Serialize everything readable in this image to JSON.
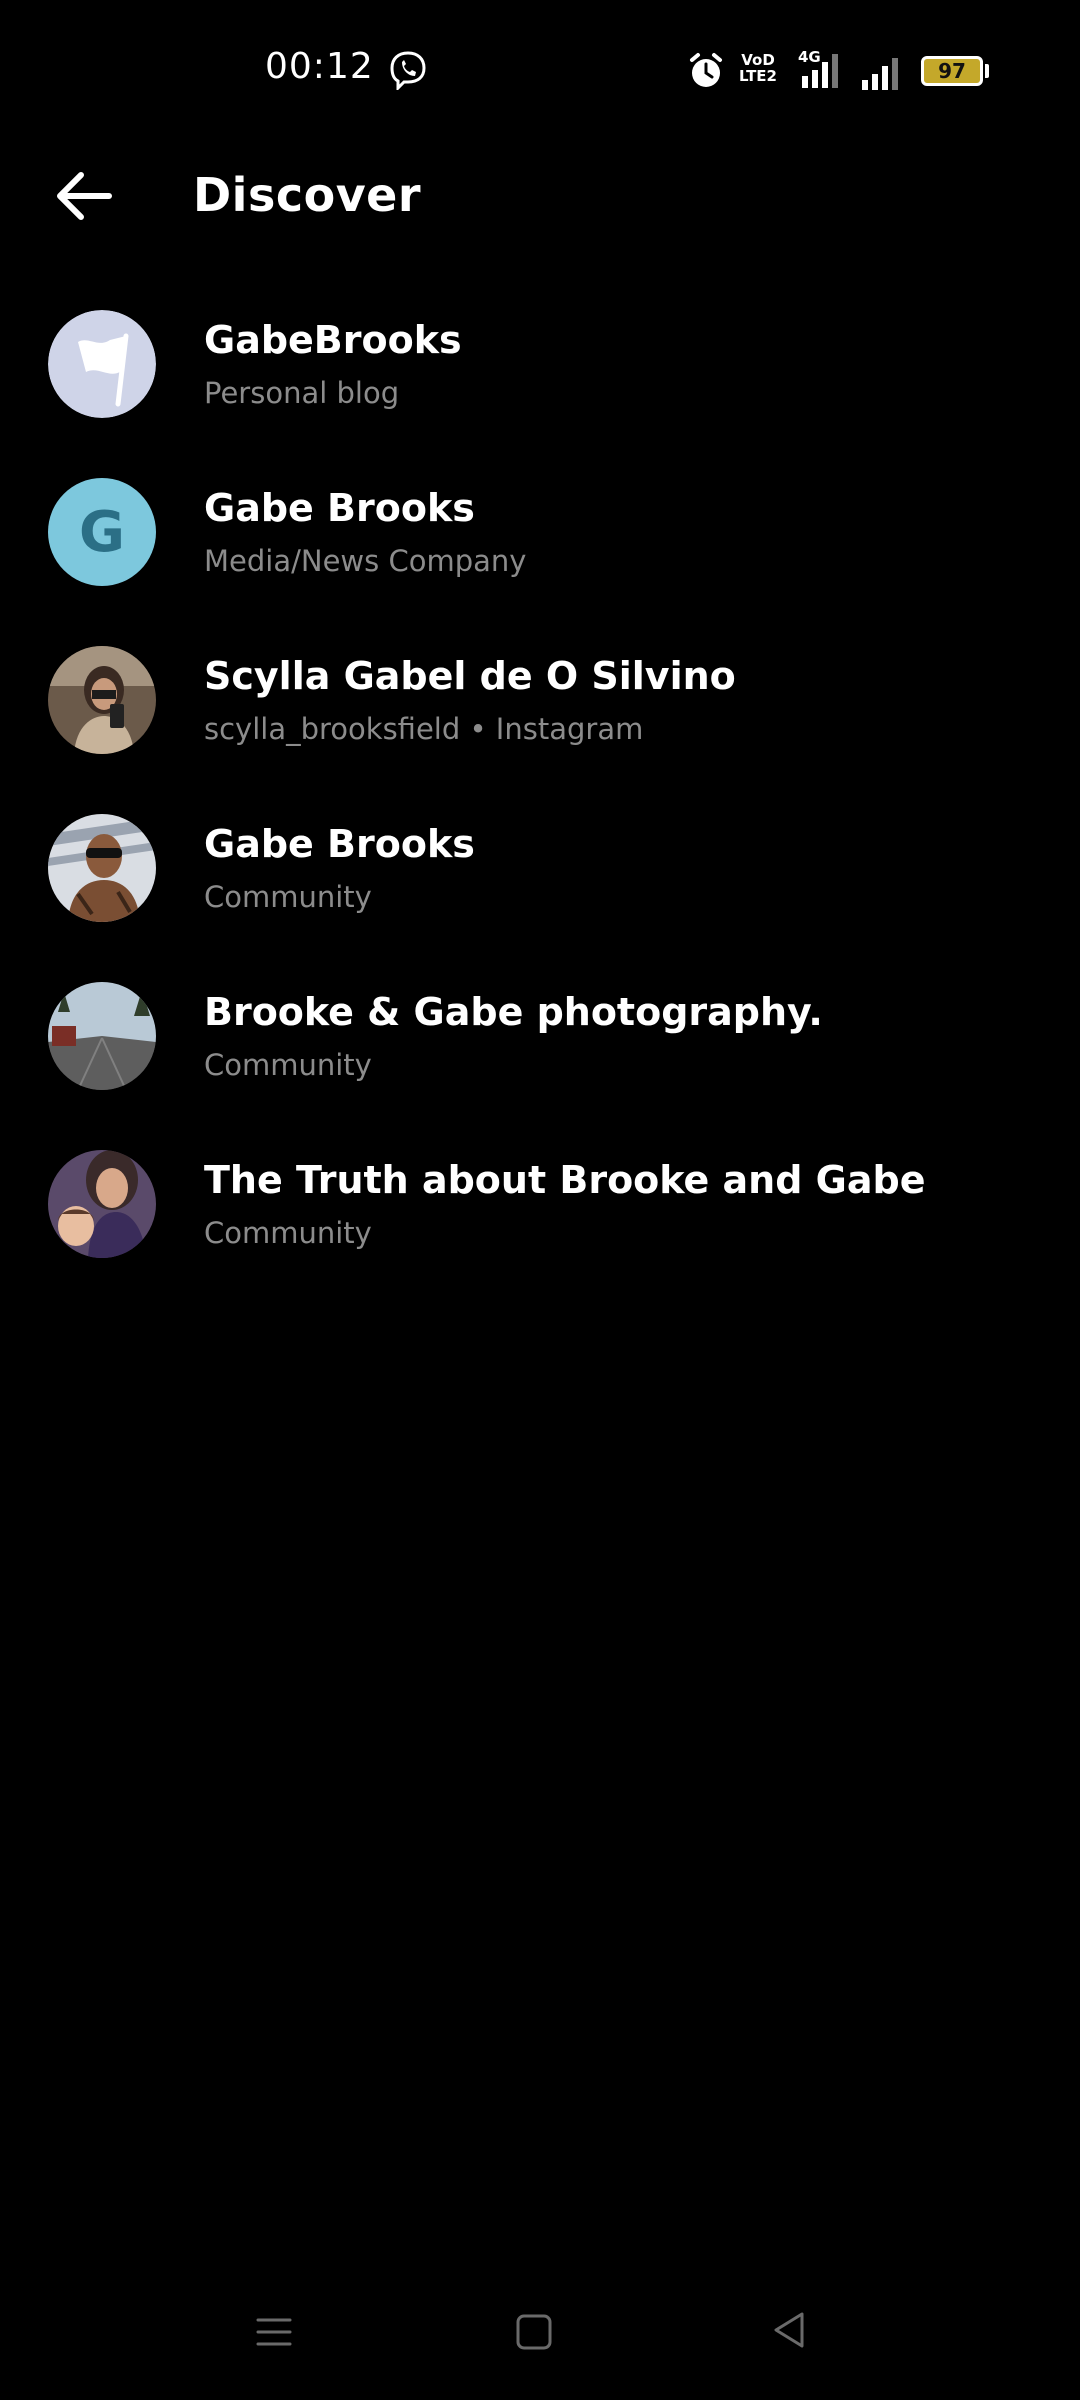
{
  "status_bar": {
    "time": "00:12",
    "volte_label": "VoD LTE2",
    "network_type": "4G",
    "battery_level": "97"
  },
  "header": {
    "title": "Discover"
  },
  "results": [
    {
      "name": "GabeBrooks",
      "subtitle": "Personal blog",
      "avatar": "flag-icon"
    },
    {
      "name": "Gabe Brooks",
      "subtitle": "Media/News Company",
      "avatar": "letter",
      "avatar_letter": "G"
    },
    {
      "name": "Scylla Gabel de O Silvino",
      "subtitle": "scylla_brooksfield • Instagram",
      "avatar": "photo"
    },
    {
      "name": "Gabe Brooks",
      "subtitle": "Community",
      "avatar": "photo"
    },
    {
      "name": "Brooke & Gabe photography.",
      "subtitle": "Community",
      "avatar": "photo"
    },
    {
      "name": "The Truth about Brooke and Gabe",
      "subtitle": "Community",
      "avatar": "photo"
    }
  ],
  "colors": {
    "background": "#000000",
    "text_primary": "#ffffff",
    "text_secondary": "#8c8c8c",
    "battery": "#c4a82a",
    "letter_avatar_bg": "#7dc8dd",
    "letter_avatar_fg": "#2b6f86"
  }
}
